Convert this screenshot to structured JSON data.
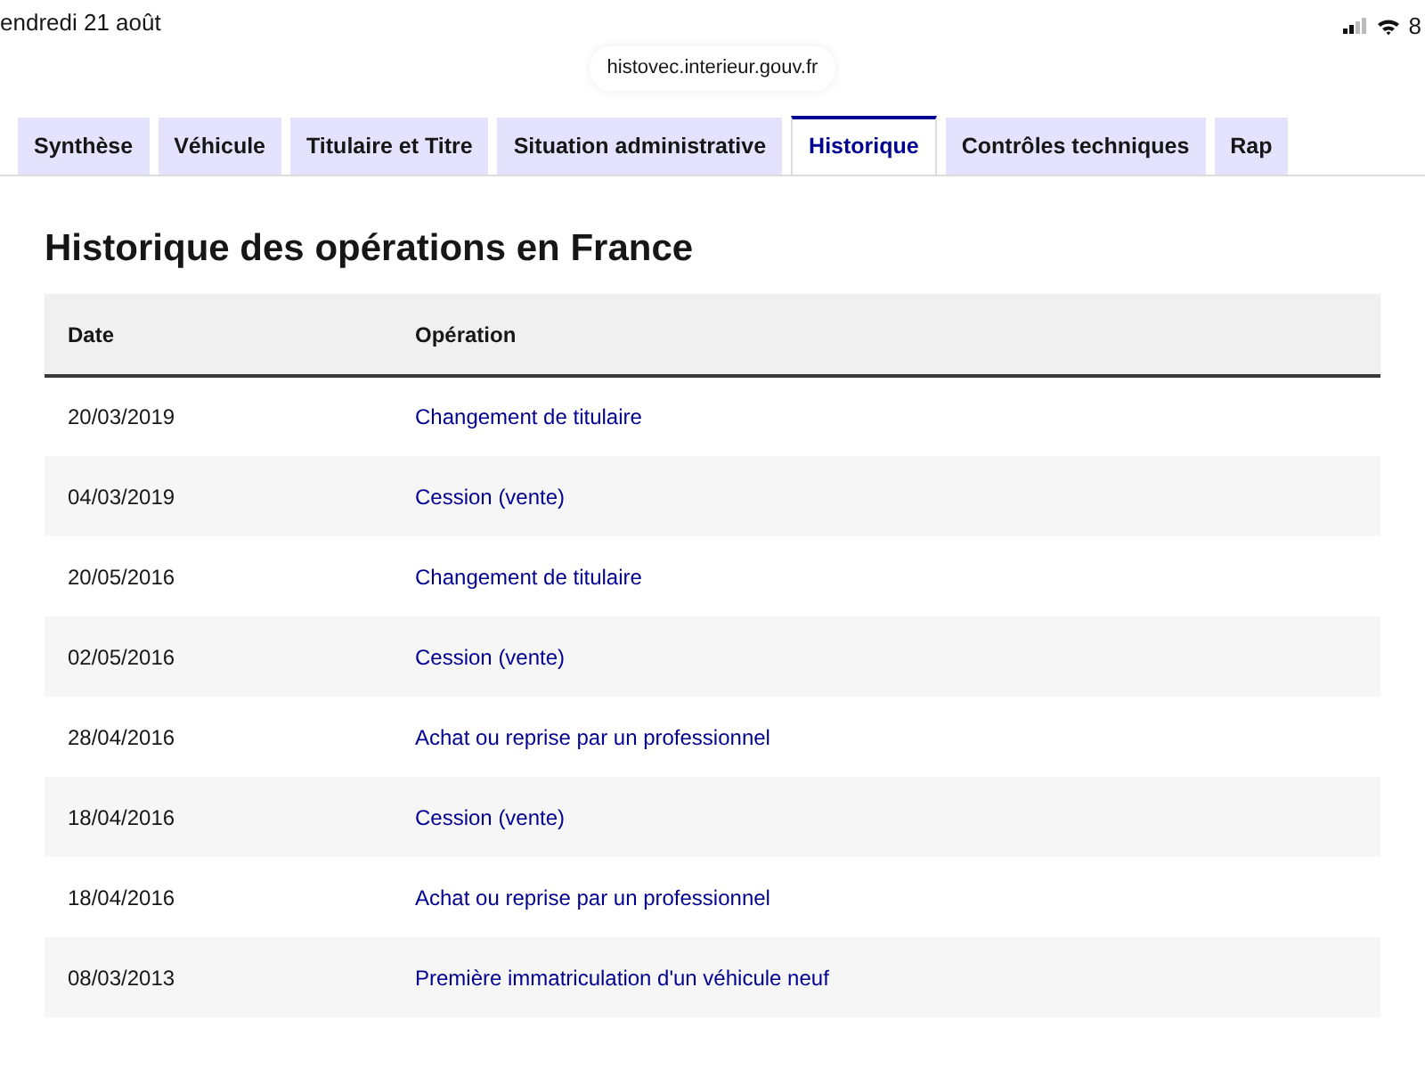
{
  "status_bar": {
    "date": "endredi 21 août",
    "battery": "8"
  },
  "address_bar": {
    "url": "histovec.interieur.gouv.fr"
  },
  "tabs": [
    {
      "label": "Synthèse",
      "selected": false
    },
    {
      "label": "Véhicule",
      "selected": false
    },
    {
      "label": "Titulaire et Titre",
      "selected": false
    },
    {
      "label": "Situation administrative",
      "selected": false
    },
    {
      "label": "Historique",
      "selected": true
    },
    {
      "label": "Contrôles techniques",
      "selected": false
    },
    {
      "label": "Rap",
      "selected": false
    }
  ],
  "section": {
    "title": "Historique des opérations en France",
    "table": {
      "columns": [
        "Date",
        "Opération"
      ],
      "rows": [
        [
          "20/03/2019",
          "Changement de titulaire"
        ],
        [
          "04/03/2019",
          "Cession (vente)"
        ],
        [
          "20/05/2016",
          "Changement de titulaire"
        ],
        [
          "02/05/2016",
          "Cession (vente)"
        ],
        [
          "28/04/2016",
          "Achat ou reprise par un professionnel"
        ],
        [
          "18/04/2016",
          "Cession (vente)"
        ],
        [
          "18/04/2016",
          "Achat ou reprise par un professionnel"
        ],
        [
          "08/03/2013",
          "Première immatriculation d'un véhicule neuf"
        ]
      ]
    }
  }
}
